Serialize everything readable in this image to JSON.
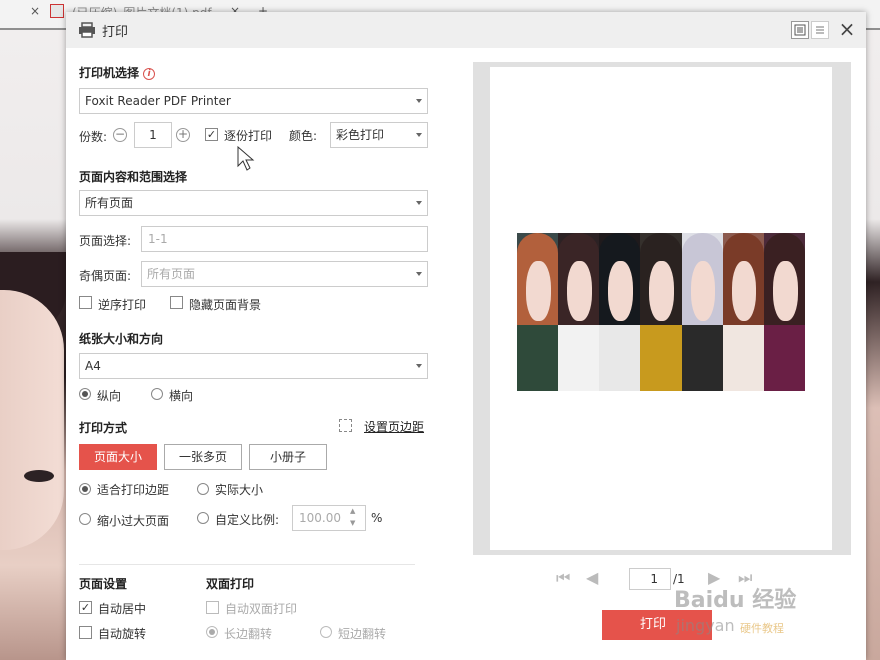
{
  "background": {
    "tab_close": "×",
    "tab_title": "(已压缩)_图片文档(1).pdf",
    "tab_close_2": "×",
    "new_tab": "+"
  },
  "dialog": {
    "title": "打印",
    "close": "×",
    "accent_color": "#e5534b"
  },
  "printer": {
    "section_title": "打印机选择",
    "info_icon": "i",
    "selected": "Foxit Reader PDF Printer",
    "copies_label": "份数:",
    "minus": "−",
    "copies_value": "1",
    "plus": "+",
    "collate_label": "逐份打印",
    "collate_checked": true,
    "color_label": "颜色:",
    "color_selected": "彩色打印"
  },
  "range": {
    "section_title": "页面内容和范围选择",
    "content_selected": "所有页面",
    "page_select_label": "页面选择:",
    "page_select_placeholder": "1-1",
    "odd_even_label": "奇偶页面:",
    "odd_even_selected": "所有页面",
    "reverse_label": "逆序打印",
    "hide_bg_label": "隐藏页面背景"
  },
  "paper": {
    "section_title": "纸张大小和方向",
    "size_selected": "A4",
    "portrait_label": "纵向",
    "landscape_label": "横向",
    "orientation": "portrait"
  },
  "mode": {
    "section_title": "打印方式",
    "margin_link": "设置页边距",
    "buttons": [
      "页面大小",
      "一张多页",
      "小册子"
    ],
    "active": "页面大小",
    "fit_label": "适合打印边距",
    "actual_label": "实际大小",
    "shrink_label": "缩小过大页面",
    "custom_label": "自定义比例:",
    "scale_value": "100.00",
    "percent": "%"
  },
  "page_setup": {
    "section_title": "页面设置",
    "auto_center_label": "自动居中",
    "auto_center_checked": true,
    "auto_rotate_label": "自动旋转"
  },
  "duplex": {
    "section_title": "双面打印",
    "auto_duplex_label": "自动双面打印",
    "long_edge_label": "长边翻转",
    "short_edge_label": "短边翻转"
  },
  "preview": {
    "current_page": "1",
    "total_pages": "/1"
  },
  "actions": {
    "print_label": "打印"
  },
  "watermark": {
    "text_main": "Baidu 经验",
    "text_sub": "jingyan",
    "text_badge": "硬件教程"
  }
}
